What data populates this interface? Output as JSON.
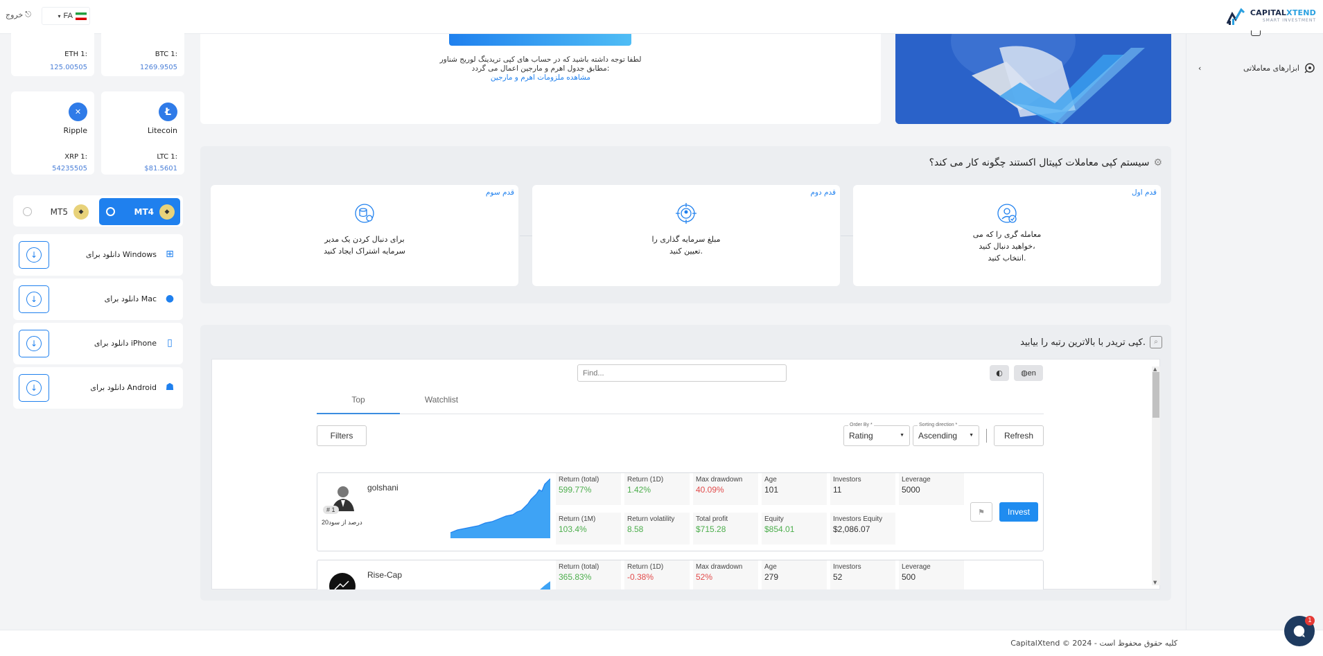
{
  "header": {
    "logo_brand_a": "CAPITAL",
    "logo_brand_b": "XTEND",
    "logo_sub": "SMART INVESTMENT",
    "lang": "FA",
    "logout": "خروج"
  },
  "sidebar": {
    "item": "ابزارهای معاملاتی"
  },
  "crypto": [
    {
      "name": "",
      "pair": "BTC 1:",
      "value": "1269.9505"
    },
    {
      "name": "",
      "pair": "ETH 1:",
      "value": "125.00505"
    },
    {
      "name": "Litecoin",
      "pair": "LTC 1:",
      "value": "$81.5601"
    },
    {
      "name": "Ripple",
      "pair": "XRP 1:",
      "value": "54235505"
    }
  ],
  "platforms": {
    "mt4": "MT4",
    "mt5": "MT5"
  },
  "downloads": [
    {
      "label": "دانلود برای Windows"
    },
    {
      "label": "دانلود برای Mac"
    },
    {
      "label": "دانلود برای iPhone"
    },
    {
      "label": "دانلود برای Android"
    }
  ],
  "note": {
    "line1": "لطفا توجه داشته باشید که در حساب های کپی تریدینگ لوریج شناور",
    "line2": "مطابق جدول اهرم و مارجین اعمال می گردد:",
    "link": "مشاهده ملزومات اهرم و مارجین"
  },
  "how": {
    "title": "سیستم کپی معاملات کپیتال اکستند چگونه کار می کند؟",
    "steps": [
      {
        "tag": "قدم اول",
        "l1": "معامله گری را که می",
        "l2": "خواهید دنبال کنید،",
        "l3": "انتخاب کنید."
      },
      {
        "tag": "قدم دوم",
        "l1": "مبلغ سرمایه گذاری را",
        "l2": "تعیین کنید.",
        "l3": ""
      },
      {
        "tag": "قدم سوم",
        "l1": "برای دنبال کردن یک مدیر",
        "l2": "سرمایه اشتراک ایجاد کنید",
        "l3": ""
      }
    ]
  },
  "traders": {
    "title": "کپی تریدر با بالاترین رتبه را بیابید.",
    "find_placeholder": "Find...",
    "lang_btn": "en",
    "tabs": {
      "top": "Top",
      "watchlist": "Watchlist"
    },
    "filters": "Filters",
    "order_by": {
      "caption": "Order By *",
      "value": "Rating"
    },
    "sort_dir": {
      "caption": "Sorting direction *",
      "value": "Ascending"
    },
    "refresh": "Refresh",
    "invest": "Invest",
    "rows": [
      {
        "name": "golshani",
        "rank": "# 1",
        "sub": "20درصد از سود",
        "cells": [
          {
            "k": "Return (total)",
            "v": "599.77%",
            "c": "g"
          },
          {
            "k": "Return (1D)",
            "v": "1.42%",
            "c": "g"
          },
          {
            "k": "Max drawdown",
            "v": "40.09%",
            "c": "r"
          },
          {
            "k": "Age",
            "v": "101",
            "c": ""
          },
          {
            "k": "Investors",
            "v": "11",
            "c": ""
          },
          {
            "k": "Leverage",
            "v": "5000",
            "c": ""
          },
          {
            "k": "Return (1M)",
            "v": "103.4%",
            "c": "g"
          },
          {
            "k": "Return volatility",
            "v": "8.58",
            "c": "g"
          },
          {
            "k": "Total profit",
            "v": "$715.28",
            "c": "g"
          },
          {
            "k": "Equity",
            "v": "$854.01",
            "c": "g"
          },
          {
            "k": "Investors Equity",
            "v": "$2,086.07",
            "c": ""
          }
        ]
      },
      {
        "name": "Rise-Cap",
        "rank": "",
        "sub": "",
        "cells": [
          {
            "k": "Return (total)",
            "v": "365.83%",
            "c": "g"
          },
          {
            "k": "Return (1D)",
            "v": "-0.38%",
            "c": "r"
          },
          {
            "k": "Max drawdown",
            "v": "52%",
            "c": "r"
          },
          {
            "k": "Age",
            "v": "279",
            "c": ""
          },
          {
            "k": "Investors",
            "v": "52",
            "c": ""
          },
          {
            "k": "Leverage",
            "v": "500",
            "c": ""
          }
        ]
      }
    ]
  },
  "footer": {
    "copyright": "CapitalXtend © 2024 - کلیه حقوق محفوظ است",
    "chat_badge": "1"
  },
  "colors": {
    "accent": "#1f80ee",
    "positive": "#4cae4c",
    "negative": "#e24b4b"
  }
}
